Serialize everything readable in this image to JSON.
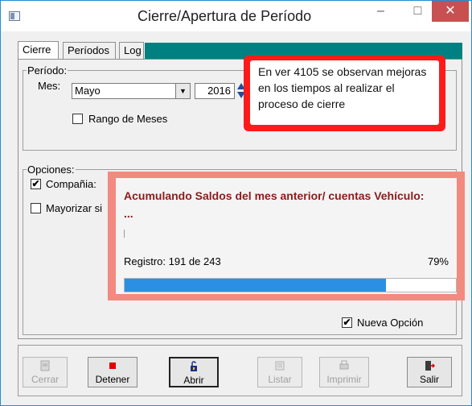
{
  "window": {
    "title": "Cierre/Apertura de Período",
    "min_glyph": "–",
    "max_glyph": "□",
    "close_glyph": "✕"
  },
  "tabs": [
    {
      "label": "Cierre",
      "active": true
    },
    {
      "label": "Períodos",
      "active": false
    },
    {
      "label": "Log",
      "active": false
    }
  ],
  "periodo": {
    "legend": "Período:",
    "mes_label": "Mes:",
    "mes_value": "Mayo",
    "year_value": "2016",
    "rango_label": "Rango de Meses",
    "rango_checked": false
  },
  "opciones": {
    "legend": "Opciones:",
    "compania_label": "Compañia:",
    "compania_checked": true,
    "mayorizar_label": "Mayorizar si",
    "mayorizar_checked": false
  },
  "callout": {
    "text": "En ver 4105 se observan mejoras en los tiempos al realizar el proceso de cierre"
  },
  "progress": {
    "title": "Acumulando Saldos del mes anterior/ cuentas Vehículo:",
    "subtitle": "...",
    "registro": "Registro: 191 de 243",
    "percent_text": "79%",
    "fraction": 0.79
  },
  "nueva_opcion": {
    "label": "Nueva Opción",
    "checked": true
  },
  "buttons": [
    {
      "label": "Cerrar",
      "icon": "document-icon",
      "enabled": false
    },
    {
      "label": "Detener",
      "icon": "stop-icon",
      "enabled": true
    },
    {
      "label": "Abrir",
      "icon": "lock-open-icon",
      "enabled": true
    },
    {
      "label": "Listar",
      "icon": "list-icon",
      "enabled": false
    },
    {
      "label": "Imprimir",
      "icon": "printer-icon",
      "enabled": false
    },
    {
      "label": "Salir",
      "icon": "exit-icon",
      "enabled": true
    }
  ],
  "colors": {
    "accent_tab_band": "#008080",
    "callout_border": "#ff1a1a",
    "progress_frame": "#f28a80",
    "progress_fill": "#2b8fe3",
    "progress_title": "#8a1c1c"
  },
  "check_glyph": "✔"
}
